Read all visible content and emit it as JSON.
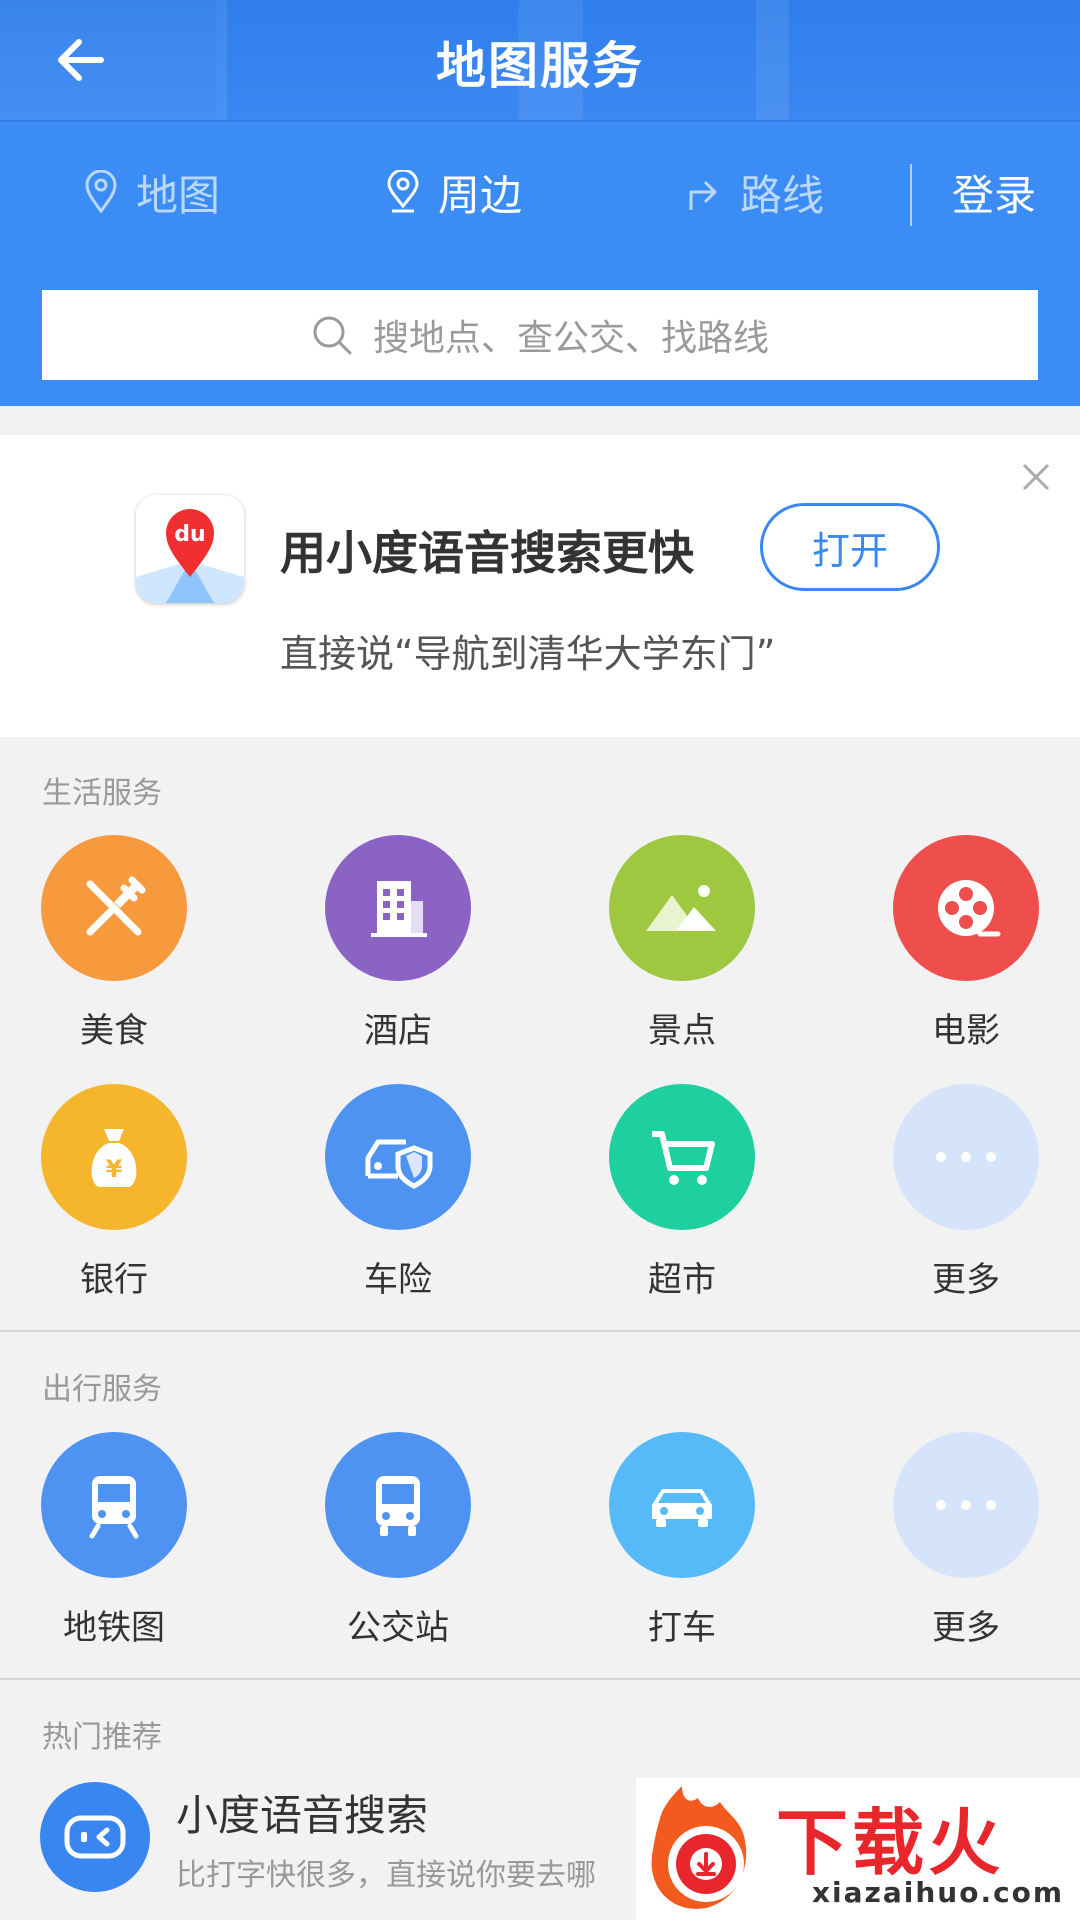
{
  "header": {
    "title": "地图服务"
  },
  "tabs": [
    {
      "label": "地图",
      "icon": "map-pin-icon",
      "active": false
    },
    {
      "label": "周边",
      "icon": "nearby-pin-icon",
      "active": true
    },
    {
      "label": "路线",
      "icon": "route-arrow-icon",
      "active": false
    }
  ],
  "login_label": "登录",
  "search": {
    "placeholder": "搜地点、查公交、找路线"
  },
  "promo": {
    "title": "用小度语音搜索更快",
    "button": "打开",
    "subtitle": "直接说“导航到清华大学东门”",
    "icon_text": "du"
  },
  "life_services": {
    "title": "生活服务",
    "items": [
      {
        "label": "美食",
        "icon": "food-icon",
        "color": "#f7993d"
      },
      {
        "label": "酒店",
        "icon": "hotel-icon",
        "color": "#8b63c4"
      },
      {
        "label": "景点",
        "icon": "scenery-icon",
        "color": "#9dc840"
      },
      {
        "label": "电影",
        "icon": "film-icon",
        "color": "#ef4f4c"
      },
      {
        "label": "银行",
        "icon": "bank-icon",
        "color": "#f5b52c"
      },
      {
        "label": "车险",
        "icon": "car-insurance-icon",
        "color": "#4e93f2"
      },
      {
        "label": "超市",
        "icon": "cart-icon",
        "color": "#1ecfa0"
      },
      {
        "label": "更多",
        "icon": "more-icon",
        "color": "#d6e4fb"
      }
    ]
  },
  "travel_services": {
    "title": "出行服务",
    "items": [
      {
        "label": "地铁图",
        "icon": "subway-icon",
        "color": "#4e93f2"
      },
      {
        "label": "公交站",
        "icon": "bus-icon",
        "color": "#4e93f2"
      },
      {
        "label": "打车",
        "icon": "taxi-icon",
        "color": "#56baf8"
      },
      {
        "label": "更多",
        "icon": "more-icon",
        "color": "#d6e4fb"
      }
    ]
  },
  "hot": {
    "title": "热门推荐",
    "item_title": "小度语音搜索",
    "item_desc": "比打字快很多，直接说你要去哪"
  },
  "watermark": {
    "text": "下载火",
    "url": "xiazaihuo.com"
  }
}
